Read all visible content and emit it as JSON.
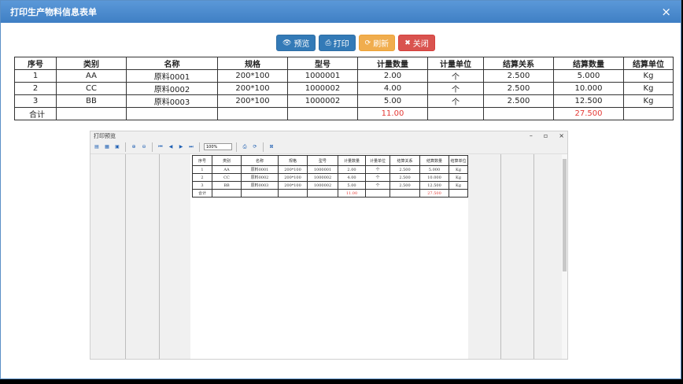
{
  "dialog": {
    "title": "打印生产物料信息表单",
    "close_symbol": "×"
  },
  "toolbar": {
    "preview_label": "预览",
    "print_label": "打印",
    "refresh_label": "刷新",
    "close_label": "关闭"
  },
  "table": {
    "headers": [
      "序号",
      "类别",
      "名称",
      "规格",
      "型号",
      "计量数量",
      "计量单位",
      "结算关系",
      "结算数量",
      "结算单位"
    ],
    "rows": [
      [
        "1",
        "AA",
        "原料0001",
        "200*100",
        "1000001",
        "2.00",
        "个",
        "2.500",
        "5.000",
        "Kg"
      ],
      [
        "2",
        "CC",
        "原料0002",
        "200*100",
        "1000002",
        "4.00",
        "个",
        "2.500",
        "10.000",
        "Kg"
      ],
      [
        "3",
        "BB",
        "原料0003",
        "200*100",
        "1000002",
        "5.00",
        "个",
        "2.500",
        "12.500",
        "Kg"
      ]
    ],
    "total_label": "合计",
    "total_quantity": "11.00",
    "total_settle": "27.500"
  },
  "preview": {
    "title": "打印预览",
    "zoom": "100%",
    "win_min": "–",
    "win_max": "▫",
    "win_close": "×",
    "headers": [
      "序号",
      "类别",
      "名称",
      "规格",
      "型号",
      "计量数量",
      "计量单位",
      "结算关系",
      "结算数量",
      "结算单位"
    ],
    "rows": [
      [
        "1",
        "AA",
        "原料0001",
        "200*100",
        "1000001",
        "2.00",
        "个",
        "2.500",
        "5.000",
        "Kg"
      ],
      [
        "2",
        "CC",
        "原料0002",
        "200*100",
        "1000002",
        "4.00",
        "个",
        "2.500",
        "10.000",
        "Kg"
      ],
      [
        "3",
        "BB",
        "原料0003",
        "200*100",
        "1000002",
        "5.00",
        "个",
        "2.500",
        "12.500",
        "Kg"
      ]
    ],
    "total_label": "合计",
    "total_quantity": "11.00",
    "total_settle": "27.500"
  },
  "colors": {
    "title_bar": "#4a8ad0",
    "primary": "#337ab7",
    "warning": "#f0ad4e",
    "danger": "#d9534f",
    "total_text": "#e53935"
  }
}
